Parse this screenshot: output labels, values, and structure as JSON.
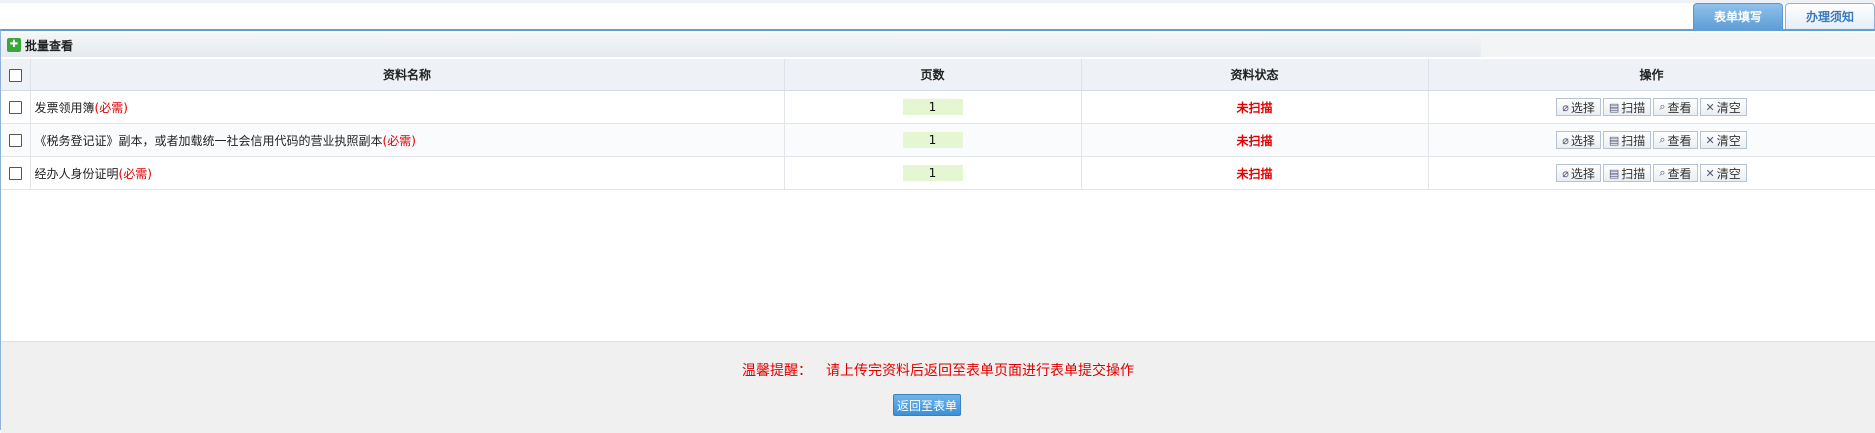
{
  "tabs": [
    {
      "label": "表单填写"
    },
    {
      "label": "办理须知"
    }
  ],
  "toolbar": {
    "icon": "add-icon",
    "label": "批量查看"
  },
  "table": {
    "headers": {
      "name": "资料名称",
      "pages": "页数",
      "status": "资料状态",
      "ops": "操作"
    },
    "rows": [
      {
        "name": "发票领用簿",
        "required": "(必需)",
        "pages": "1",
        "status": "未扫描"
      },
      {
        "name": "《税务登记证》副本，或者加载统一社会信用代码的营业执照副本",
        "required": "(必需)",
        "pages": "1",
        "status": "未扫描"
      },
      {
        "name": "经办人身份证明",
        "required": "(必需)",
        "pages": "1",
        "status": "未扫描"
      }
    ],
    "actions": {
      "select": "选择",
      "scan": "扫描",
      "view": "查看",
      "clear": "清空"
    }
  },
  "footer": {
    "tip_label": "温馨提醒：",
    "tip_text": "请上传完资料后返回至表单页面进行表单提交操作",
    "back_button": "返回至表单"
  },
  "colors": {
    "accent": "#5f9ed6",
    "required": "#e00000",
    "page_box": "#e4f6d2"
  }
}
